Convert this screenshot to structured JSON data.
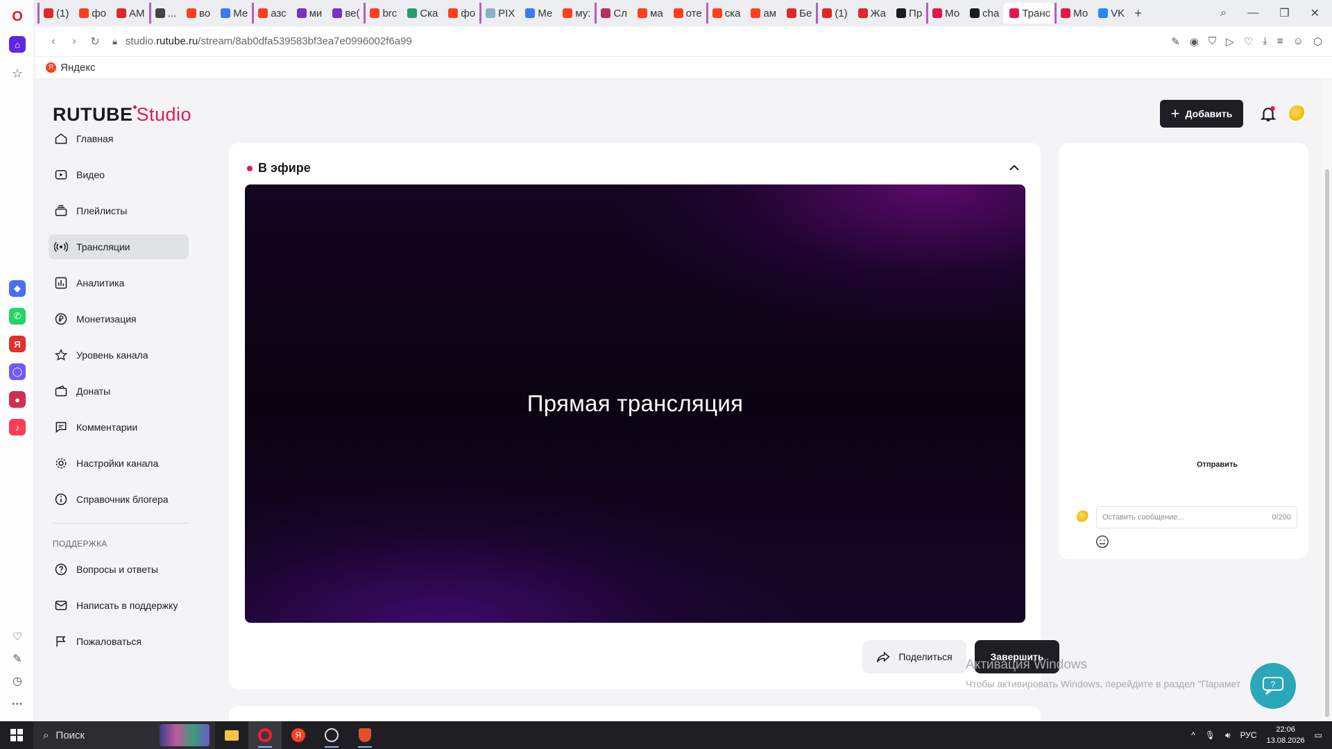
{
  "browser": {
    "tabs": [
      {
        "label": "(1)",
        "color": "#e02828"
      },
      {
        "label": "фо",
        "color": "#fc3f1d"
      },
      {
        "label": "АМ",
        "color": "#e02828"
      },
      {
        "label": "...",
        "color": "#444444"
      },
      {
        "label": "во",
        "color": "#fc3f1d"
      },
      {
        "label": "Ме",
        "color": "#3a7bf0"
      },
      {
        "label": "азс",
        "color": "#fc3f1d"
      },
      {
        "label": "ми",
        "color": "#7a30c0"
      },
      {
        "label": "ве(",
        "color": "#7a30c0"
      },
      {
        "label": "brc",
        "color": "#fc3f1d"
      },
      {
        "label": "Ска",
        "color": "#2a9a70"
      },
      {
        "label": "фо",
        "color": "#fc3f1d"
      },
      {
        "label": "PIX",
        "color": "#8ab0c8"
      },
      {
        "label": "Ме",
        "color": "#3a7bf0"
      },
      {
        "label": "му:",
        "color": "#fc3f1d"
      },
      {
        "label": "Сл",
        "color": "#b03060"
      },
      {
        "label": "ма",
        "color": "#fc3f1d"
      },
      {
        "label": "оте",
        "color": "#fc3f1d"
      },
      {
        "label": "ска",
        "color": "#fc3f1d"
      },
      {
        "label": "ам",
        "color": "#fc3f1d"
      },
      {
        "label": "Бе",
        "color": "#e02828"
      },
      {
        "label": "(1)",
        "color": "#e02828"
      },
      {
        "label": "Жа",
        "color": "#e02828"
      },
      {
        "label": "Пр",
        "color": "#1b1b1f"
      },
      {
        "label": "Мо",
        "color": "#e3174e"
      },
      {
        "label": "cha",
        "color": "#1b1b1f"
      },
      {
        "label": "Транс",
        "color": "#e3174e",
        "active": true
      },
      {
        "label": "Мо",
        "color": "#e3174e"
      },
      {
        "label": "VK",
        "color": "#2787f5"
      }
    ],
    "new_tab": "+",
    "url_prefix": "studio.",
    "url_domain": "rutube.ru",
    "url_path": "/stream/8ab0dfa539583bf3ea7e0996002f6a99",
    "bookmark": "Яндекс"
  },
  "header": {
    "logo_main": "RUTUBE",
    "logo_studio": "Studio",
    "add_label": "Добавить"
  },
  "nav": {
    "items": [
      {
        "label": "Главная",
        "icon": "home-icon"
      },
      {
        "label": "Видео",
        "icon": "video-icon"
      },
      {
        "label": "Плейлисты",
        "icon": "playlist-icon"
      },
      {
        "label": "Трансляции",
        "icon": "broadcast-icon",
        "active": true
      },
      {
        "label": "Аналитика",
        "icon": "analytics-icon"
      },
      {
        "label": "Монетизация",
        "icon": "ruble-icon"
      },
      {
        "label": "Уровень канала",
        "icon": "star-icon"
      },
      {
        "label": "Донаты",
        "icon": "wallet-icon"
      },
      {
        "label": "Комментарии",
        "icon": "comment-icon"
      },
      {
        "label": "Настройки канала",
        "icon": "gear-icon"
      },
      {
        "label": "Справочник блогера",
        "icon": "info-icon"
      }
    ],
    "support_title": "ПОДДЕРЖКА",
    "support_items": [
      {
        "label": "Вопросы и ответы",
        "icon": "question-icon"
      },
      {
        "label": "Написать в поддержку",
        "icon": "mail-icon"
      },
      {
        "label": "Пожаловаться",
        "icon": "flag-icon"
      }
    ]
  },
  "stream": {
    "status": "В эфире",
    "player_title": "Прямая трансляция",
    "share_label": "Поделиться",
    "finish_label": "Завершить"
  },
  "chat": {
    "placeholder": "Оставить сообщение...",
    "counter": "0/200",
    "send_label": "Отправить"
  },
  "watermark": {
    "title": "Активация Windows",
    "subtitle": "Чтобы активировать Windows, перейдите в раздел \"Парамет"
  },
  "taskbar": {
    "search_label": "Поиск",
    "lang": "РУС",
    "time": "22:06",
    "date": "13.08.2026"
  },
  "colors": {
    "accent": "#e3174e",
    "button_dark": "#1e1e24",
    "help_fab": "#2aa7b8"
  }
}
